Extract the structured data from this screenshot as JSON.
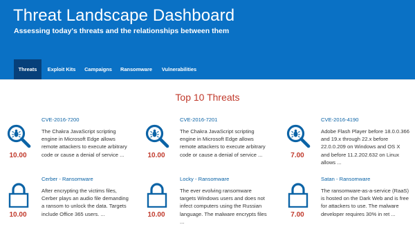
{
  "header": {
    "title": "Threat Landscape Dashboard",
    "subtitle": "Assessing today's threats and the relationships between them"
  },
  "nav": {
    "tabs": [
      {
        "label": "Threats",
        "active": true
      },
      {
        "label": "Exploit Kits",
        "active": false
      },
      {
        "label": "Campaigns",
        "active": false
      },
      {
        "label": "Ransomware",
        "active": false
      },
      {
        "label": "Vulnerabilities",
        "active": false
      }
    ]
  },
  "section": {
    "title": "Top 10 Threats"
  },
  "cards": [
    {
      "icon": "magnifier-bug-icon",
      "score": "10.00",
      "title": "CVE-2016-7200",
      "desc": "The Chakra JavaScript scripting engine in Microsoft Edge allows remote attackers to execute arbitrary code or cause a denial of service ..."
    },
    {
      "icon": "magnifier-bug-icon",
      "score": "10.00",
      "title": "CVE-2016-7201",
      "desc": "The Chakra JavaScript scripting engine in Microsoft Edge allows remote attackers to execute arbitrary code or cause a denial of service ..."
    },
    {
      "icon": "magnifier-bug-icon",
      "score": "7.00",
      "title": "CVE-2016-4190",
      "desc": "Adobe Flash Player before 18.0.0.366 and 19.x through 22.x before 22.0.0.209 on Windows and OS X and before 11.2.202.632 on Linux allows ..."
    },
    {
      "icon": "padlock-icon",
      "score": "10.00",
      "title": "Cerber - Ransomware",
      "desc": "After encrypting the victims files, Cerber plays an audio file demanding a ransom to unlock the data. Targets include Office 365 users. ..."
    },
    {
      "icon": "padlock-icon",
      "score": "10.00",
      "title": "Locky - Ransomware",
      "desc": "The ever evolving ransomware targets Windows users and does not infect computers using the Russian language. The malware encrypts files ..."
    },
    {
      "icon": "padlock-icon",
      "score": "7.00",
      "title": "Satan - Ransomware",
      "desc": "The ransomware-as-a-service (RaaS) is hosted on the Dark Web and is free for attackers to use. The malware developer requires 30% in ret ..."
    }
  ],
  "colors": {
    "brand_blue": "#0a71c5",
    "nav_active": "#07407a",
    "score_red": "#c0392b",
    "link_blue": "#0b63a6"
  }
}
